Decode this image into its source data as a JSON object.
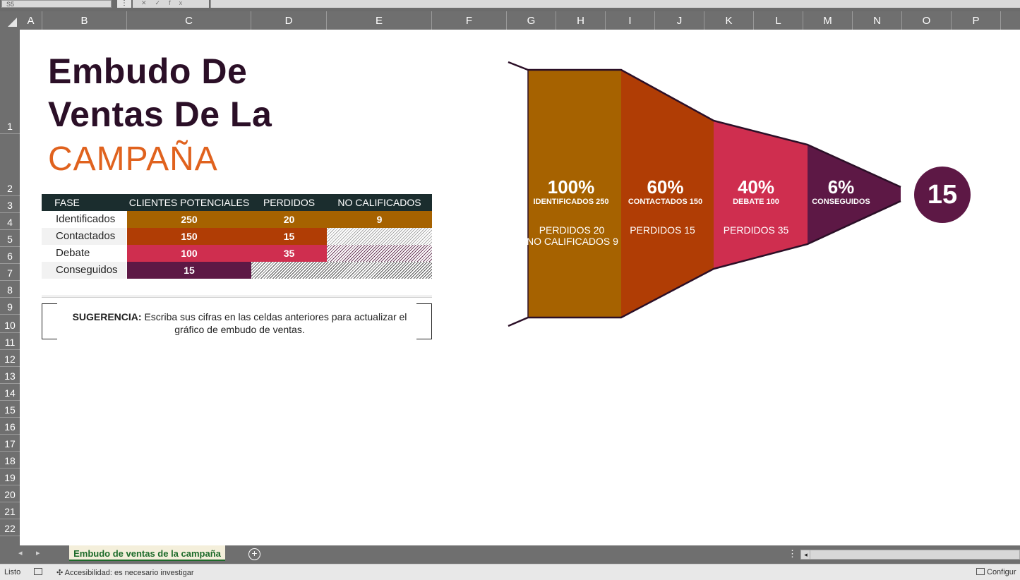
{
  "formula_bar": {
    "name_box": "S5",
    "more_glyph": "⋮",
    "fx_glyphs": "✕✓fx"
  },
  "columns": [
    "A",
    "B",
    "C",
    "D",
    "E",
    "F",
    "G",
    "H",
    "I",
    "J",
    "K",
    "L",
    "M",
    "N",
    "O",
    "P"
  ],
  "rows": [
    "1",
    "2",
    "3",
    "4",
    "5",
    "6",
    "7",
    "8",
    "9",
    "10",
    "11",
    "12",
    "13",
    "14",
    "15",
    "16",
    "17",
    "18",
    "19",
    "20",
    "21",
    "22"
  ],
  "title": {
    "line1": "Embudo De",
    "line2": "Ventas De La",
    "line3": "CAMPAÑA"
  },
  "table": {
    "headers": [
      "FASE",
      "CLIENTES POTENCIALES",
      "PERDIDOS",
      "NO CALIFICADOS"
    ],
    "rows": [
      {
        "fase": "Identificados",
        "potenciales": "250",
        "perdidos": "20",
        "no_calificados": "9"
      },
      {
        "fase": "Contactados",
        "potenciales": "150",
        "perdidos": "15"
      },
      {
        "fase": "Debate",
        "potenciales": "100",
        "perdidos": "35"
      },
      {
        "fase": "Conseguidos",
        "potenciales": "15"
      }
    ]
  },
  "tip": {
    "label": "SUGERENCIA:",
    "text": " Escriba sus cifras en las celdas anteriores para actualizar el gráfico de embudo de ventas."
  },
  "funnel": {
    "stages": [
      {
        "pct": "100%",
        "name": "IDENTIFICADOS 250",
        "lost1": "PERDIDOS 20",
        "lost2": "NO CALIFICADOS 9",
        "color": "#a66200"
      },
      {
        "pct": "60%",
        "name": "CONTACTADOS 150",
        "lost1": "PERDIDOS 15",
        "lost2": "",
        "color": "#b03d05"
      },
      {
        "pct": "40%",
        "name": "DEBATE 100",
        "lost1": "PERDIDOS 35",
        "lost2": "",
        "color": "#cf2e4f"
      },
      {
        "pct": "6%",
        "name": "CONSEGUIDOS",
        "lost1": "",
        "lost2": "",
        "color": "#5d1845"
      }
    ],
    "result": "15",
    "outline_color": "#2b0f27"
  },
  "colors": {
    "identificados": "#a66200",
    "contactados": "#b03d05",
    "debate": "#cf2e4f",
    "conseguidos": "#5d1845",
    "header_bg": "#1b2d2e",
    "title_dark": "#2b0f27",
    "title_orange": "#e0621e"
  },
  "sheet_tabs": {
    "active": "Embudo de ventas de la campaña"
  },
  "status_bar": {
    "ready": "Listo",
    "accessibility": "Accesibilidad: es necesario investigar",
    "settings": "Configur"
  }
}
